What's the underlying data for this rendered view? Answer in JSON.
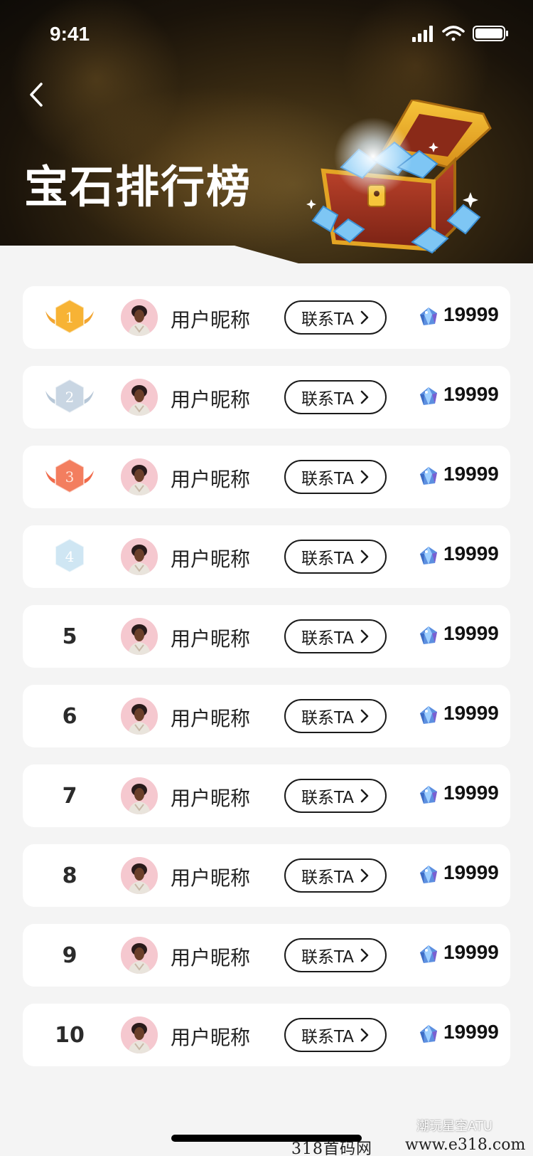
{
  "status_bar": {
    "time": "9:41"
  },
  "header": {
    "title": "宝石排行榜"
  },
  "colors": {
    "gold": "#f7b335",
    "silver": "#c9d6e3",
    "bronze": "#f37e5f",
    "fourth": "#cfe6f3",
    "card_bg": "#ffffff",
    "page_bg": "#f4f4f4"
  },
  "leaderboard": [
    {
      "rank": "1",
      "badge": "gold-badge-icon",
      "nickname": "用户昵称",
      "contact_label": "联系TA",
      "score": "19999"
    },
    {
      "rank": "2",
      "badge": "silver-badge-icon",
      "nickname": "用户昵称",
      "contact_label": "联系TA",
      "score": "19999"
    },
    {
      "rank": "3",
      "badge": "bronze-badge-icon",
      "nickname": "用户昵称",
      "contact_label": "联系TA",
      "score": "19999"
    },
    {
      "rank": "4",
      "badge": "blue-badge-icon",
      "nickname": "用户昵称",
      "contact_label": "联系TA",
      "score": "19999"
    },
    {
      "rank": "5",
      "nickname": "用户昵称",
      "contact_label": "联系TA",
      "score": "19999"
    },
    {
      "rank": "6",
      "nickname": "用户昵称",
      "contact_label": "联系TA",
      "score": "19999"
    },
    {
      "rank": "7",
      "nickname": "用户昵称",
      "contact_label": "联系TA",
      "score": "19999"
    },
    {
      "rank": "8",
      "nickname": "用户昵称",
      "contact_label": "联系TA",
      "score": "19999"
    },
    {
      "rank": "9",
      "nickname": "用户昵称",
      "contact_label": "联系TA",
      "score": "19999"
    },
    {
      "rank": "10",
      "nickname": "用户昵称",
      "contact_label": "联系TA",
      "score": "19999"
    }
  ],
  "watermark": {
    "account": "潮玩星空ATU",
    "site_cn": "318首码网",
    "site_url": "www.e318.com"
  }
}
